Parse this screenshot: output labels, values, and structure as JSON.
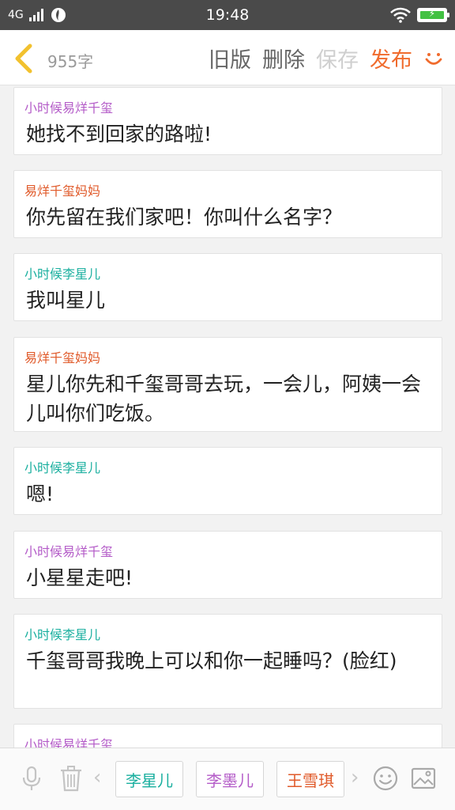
{
  "status_bar": {
    "network": "4G",
    "time": "19:48",
    "battery_charging": true
  },
  "header": {
    "word_count": "955字",
    "actions": {
      "old_version": "旧版",
      "delete": "删除",
      "save": "保存",
      "publish": "发布"
    }
  },
  "messages": [
    {
      "speaker": "小时候易烊千玺",
      "color": "#b45cc8",
      "text": "她找不到回家的路啦!"
    },
    {
      "speaker": "易烊千玺妈妈",
      "color": "#e05a2a",
      "text": "你先留在我们家吧！你叫什么名字？"
    },
    {
      "speaker": "小时候李星儿",
      "color": "#1aaf9f",
      "text": "我叫星儿"
    },
    {
      "speaker": "易烊千玺妈妈",
      "color": "#e05a2a",
      "text": "星儿你先和千玺哥哥去玩，一会儿，阿姨一会儿叫你们吃饭。"
    },
    {
      "speaker": "小时候李星儿",
      "color": "#1aaf9f",
      "text": "嗯!"
    },
    {
      "speaker": "小时候易烊千玺",
      "color": "#b45cc8",
      "text": "小星星走吧!"
    },
    {
      "speaker": "小时候李星儿",
      "color": "#1aaf9f",
      "text": "千玺哥哥我晚上可以和你一起睡吗？(脸红)"
    },
    {
      "speaker": "小时候易烊千玺",
      "color": "#b45cc8",
      "text": ""
    }
  ],
  "bottom_bar": {
    "icons": [
      "microphone-icon",
      "trash-icon",
      "chevron-left-icon",
      "chevron-right-icon",
      "emoji-icon",
      "image-icon"
    ],
    "characters": [
      {
        "name": "李星儿",
        "color": "#1aaf9f"
      },
      {
        "name": "李墨儿",
        "color": "#b45cc8"
      },
      {
        "name": "王雪琪",
        "color": "#e05a2a"
      }
    ]
  }
}
